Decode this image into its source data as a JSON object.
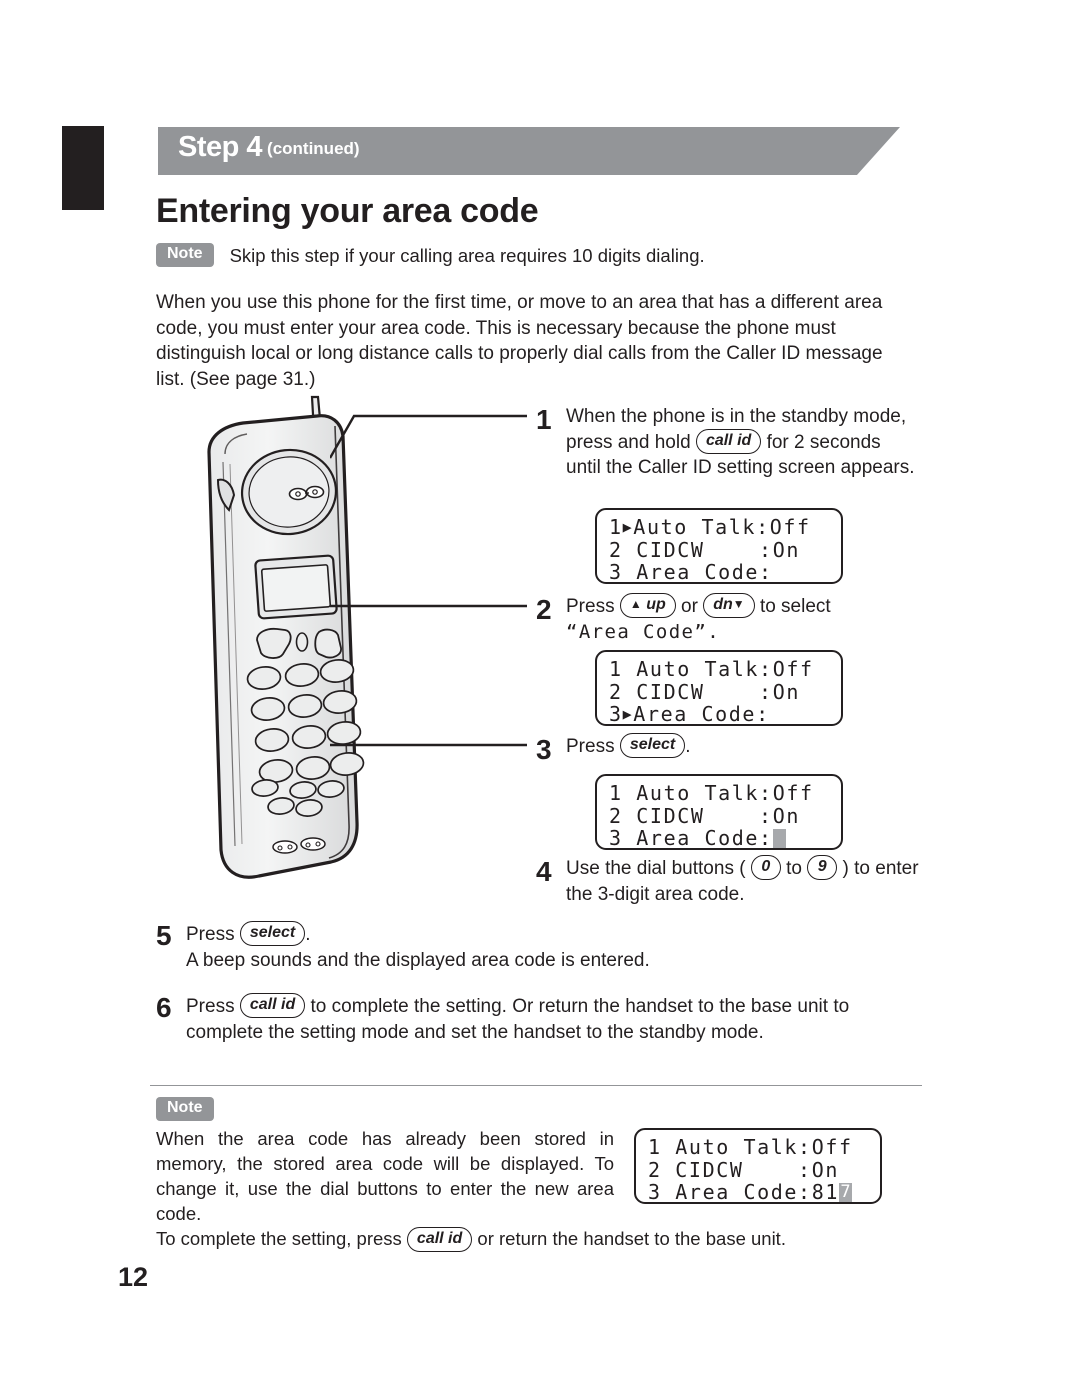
{
  "header": {
    "step_big": "Step 4",
    "step_small": "(continued)",
    "title": "Entering your area code"
  },
  "top_note": {
    "badge": "Note",
    "text": "Skip this step if your calling area requires 10 digits dialing."
  },
  "intro": "When you use this phone for the first time, or move to an area that has a different area code, you must enter your area code. This is necessary because the phone must distinguish local or long distance calls to properly dial calls from the Caller ID message list. (See page 31.)",
  "steps": {
    "s1": {
      "num": "1",
      "part1": "When the phone is in the standby mode, press and hold",
      "key": "call id",
      "part2": "for 2 seconds until the Caller ID setting screen appears."
    },
    "s2": {
      "num": "2",
      "part1": "Press",
      "key_up": "up",
      "part_or": "or",
      "key_dn": "dn",
      "part2": "to select",
      "quoted": "“Area Code”."
    },
    "s3": {
      "num": "3",
      "part1": "Press",
      "key": "select",
      "part2": "."
    },
    "s4": {
      "num": "4",
      "part1": "Use the dial buttons (",
      "key_low": "0",
      "part_to": "to",
      "key_high": "9",
      "part2": ") to enter the 3-digit area code."
    },
    "s5": {
      "num": "5",
      "part1": "Press",
      "key": "select",
      "part2": ".",
      "sub": "A beep sounds and the displayed area code is entered."
    },
    "s6": {
      "num": "6",
      "part1": "Press",
      "key": "call id",
      "part2": "to complete the setting. Or return the handset to the base unit to complete the setting mode and set the handset to the standby mode."
    }
  },
  "lcd": {
    "screen1": {
      "line1_marker": "1",
      "line1_arrow": "▶",
      "line1_text": "Auto Talk:Off",
      "line2": "2 CIDCW    :On",
      "line3": "3 Area Code:"
    },
    "screen2": {
      "line1": "1 Auto Talk:Off",
      "line2": "2 CIDCW    :On",
      "line3_marker": "3",
      "line3_arrow": "▶",
      "line3_text": "Area Code:"
    },
    "screen3": {
      "line1": "1 Auto Talk:Off",
      "line2": "2 CIDCW    :On",
      "line3": "3 Area Code:",
      "line3_cursor": ""
    },
    "screen4": {
      "line1": "1 Auto Talk:Off",
      "line2": "2 CIDCW    :On",
      "line3": "3 Area Code:81",
      "line3_cursor": "7"
    }
  },
  "bottom_note": {
    "badge": "Note",
    "body": "When the area code has already been stored in memory, the stored area code will be displayed. To change it, use the dial buttons to enter the new area code.",
    "footer_part1": "To complete the setting, press",
    "footer_key": "call id",
    "footer_part2": "or return the handset to the base unit."
  },
  "page_number": "12",
  "colors": {
    "banner_gray": "#939598",
    "ink": "#231f20",
    "cursor_gray": "#a7a9ac"
  }
}
